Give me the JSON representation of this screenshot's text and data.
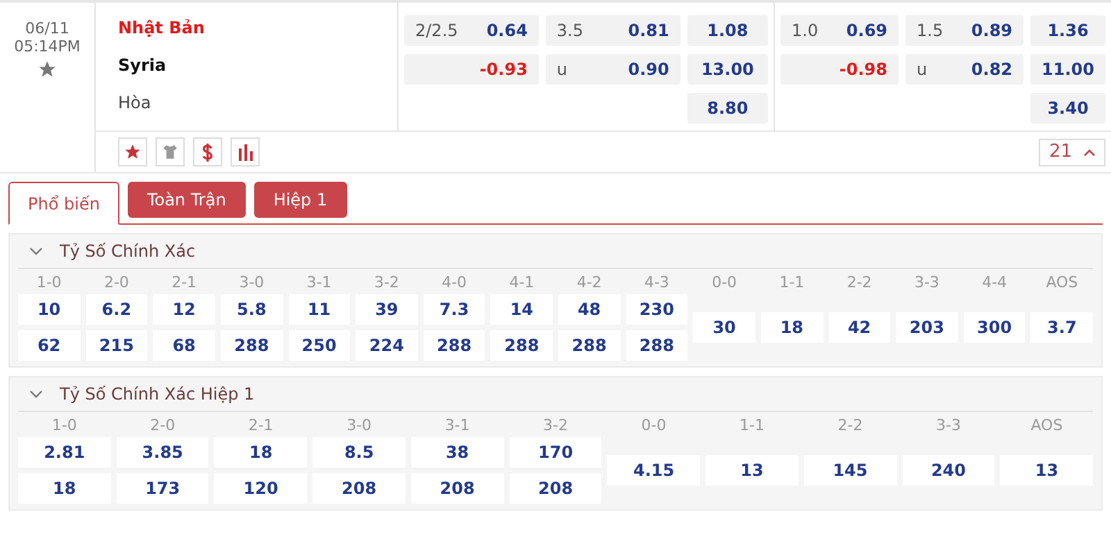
{
  "match": {
    "date": "06/11",
    "time": "05:14PM",
    "teams": [
      {
        "name": "Nhật Bản",
        "kind": "home"
      },
      {
        "name": "Syria",
        "kind": "away"
      },
      {
        "name": "Hòa",
        "kind": "draw"
      }
    ],
    "odds_groups": [
      {
        "handicap": [
          {
            "line": "2/2.5",
            "value": "0.64",
            "negative": false
          },
          {
            "value": "-0.93",
            "negative": true
          }
        ],
        "over_under": [
          {
            "line": "3.5",
            "value": "0.81",
            "negative": false
          },
          {
            "line": "u",
            "value": "0.90",
            "negative": false
          }
        ],
        "one_x_two": [
          "1.08",
          "13.00",
          "8.80"
        ]
      },
      {
        "handicap": [
          {
            "line": "1.0",
            "value": "0.69",
            "negative": false
          },
          {
            "value": "-0.98",
            "negative": true
          }
        ],
        "over_under": [
          {
            "line": "1.5",
            "value": "0.89",
            "negative": false
          },
          {
            "line": "u",
            "value": "0.82",
            "negative": false
          }
        ],
        "one_x_two": [
          "1.36",
          "11.00",
          "3.40"
        ]
      }
    ],
    "more_count": "21"
  },
  "tabs": [
    {
      "label": "Phổ biến",
      "selected": true
    },
    {
      "label": "Toàn Trận",
      "selected": false
    },
    {
      "label": "Hiệp 1",
      "selected": false
    }
  ],
  "markets": [
    {
      "title": "Tỷ Số Chính Xác",
      "expanded": true,
      "columns": [
        {
          "label": "1-0",
          "values": [
            "10",
            "62"
          ]
        },
        {
          "label": "2-0",
          "values": [
            "6.2",
            "215"
          ]
        },
        {
          "label": "2-1",
          "values": [
            "12",
            "68"
          ]
        },
        {
          "label": "3-0",
          "values": [
            "5.8",
            "288"
          ]
        },
        {
          "label": "3-1",
          "values": [
            "11",
            "250"
          ]
        },
        {
          "label": "3-2",
          "values": [
            "39",
            "224"
          ]
        },
        {
          "label": "4-0",
          "values": [
            "7.3",
            "288"
          ]
        },
        {
          "label": "4-1",
          "values": [
            "14",
            "288"
          ]
        },
        {
          "label": "4-2",
          "values": [
            "48",
            "288"
          ]
        },
        {
          "label": "4-3",
          "values": [
            "230",
            "288"
          ]
        },
        {
          "label": "0-0",
          "values": [
            "30"
          ]
        },
        {
          "label": "1-1",
          "values": [
            "18"
          ]
        },
        {
          "label": "2-2",
          "values": [
            "42"
          ]
        },
        {
          "label": "3-3",
          "values": [
            "203"
          ]
        },
        {
          "label": "4-4",
          "values": [
            "300"
          ]
        },
        {
          "label": "AOS",
          "values": [
            "3.7"
          ]
        }
      ]
    },
    {
      "title": "Tỷ Số Chính Xác Hiệp 1",
      "expanded": true,
      "columns": [
        {
          "label": "1-0",
          "values": [
            "2.81",
            "18"
          ]
        },
        {
          "label": "2-0",
          "values": [
            "3.85",
            "173"
          ]
        },
        {
          "label": "2-1",
          "values": [
            "18",
            "120"
          ]
        },
        {
          "label": "3-0",
          "values": [
            "8.5",
            "208"
          ]
        },
        {
          "label": "3-1",
          "values": [
            "38",
            "208"
          ]
        },
        {
          "label": "3-2",
          "values": [
            "170",
            "208"
          ]
        },
        {
          "label": "0-0",
          "values": [
            "4.15"
          ]
        },
        {
          "label": "1-1",
          "values": [
            "13"
          ]
        },
        {
          "label": "2-2",
          "values": [
            "145"
          ]
        },
        {
          "label": "3-3",
          "values": [
            "240"
          ]
        },
        {
          "label": "AOS",
          "values": [
            "13"
          ]
        }
      ]
    }
  ]
}
